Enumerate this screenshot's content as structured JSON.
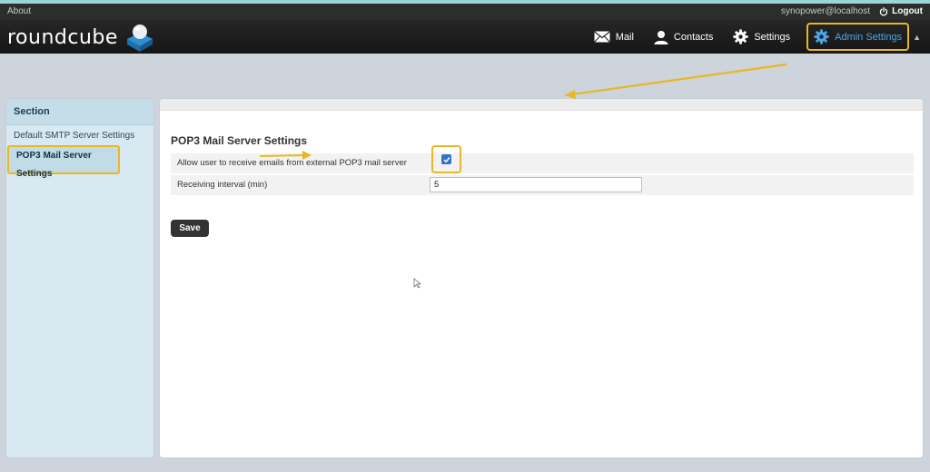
{
  "topbar": {
    "about": "About",
    "user": "synopower@localhost",
    "logout": "Logout"
  },
  "header": {
    "logo": "roundcube",
    "nav": {
      "mail": "Mail",
      "contacts": "Contacts",
      "settings": "Settings",
      "admin_settings": "Admin Settings"
    }
  },
  "sidebar": {
    "heading": "Section",
    "items": [
      {
        "label": "Default SMTP Server Settings"
      },
      {
        "label": "POP3 Mail Server Settings"
      }
    ]
  },
  "main": {
    "title": "POP3 Mail Server Settings",
    "allow_label": "Allow user to receive emails from external POP3 mail server",
    "allow_checked": true,
    "interval_label": "Receiving interval (min)",
    "interval_value": "5",
    "save_label": "Save"
  },
  "colors": {
    "accent": "#4aa8e8",
    "highlight": "#e7b726",
    "checkbox": "#2f74c7"
  }
}
